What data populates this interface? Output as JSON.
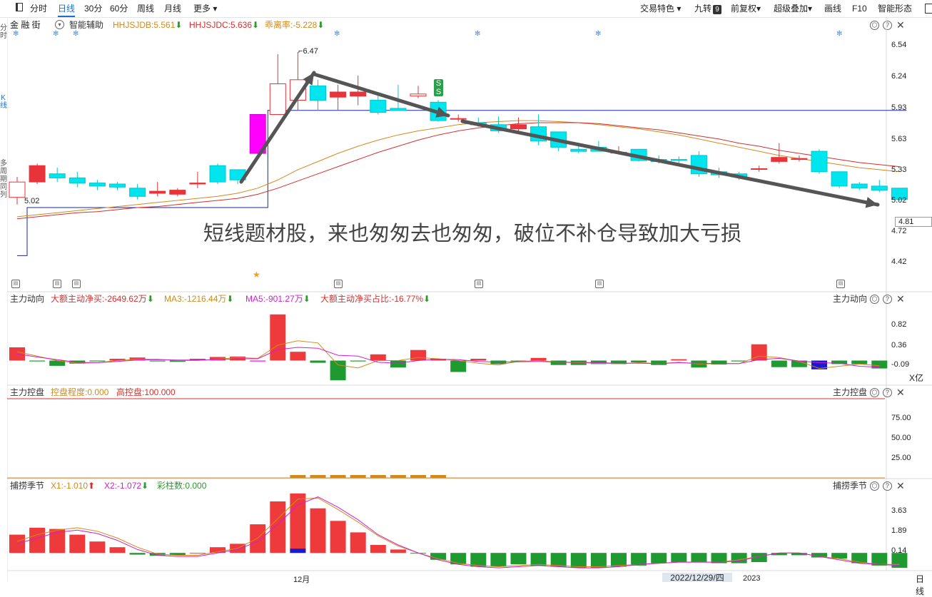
{
  "toolbar": {
    "periods": [
      "分时",
      "日线",
      "30分",
      "60分",
      "周线",
      "月线",
      "更多"
    ],
    "active_period": "日线",
    "right_items": [
      "交易特色",
      "九转",
      "前复权",
      "超级叠加",
      "画线",
      "F10",
      "智能形态"
    ],
    "jiuzhuan_badge": "9"
  },
  "stock": {
    "name": "金 融 街",
    "assist_label": "智能辅助"
  },
  "indicators": [
    {
      "label": "HHJSJDB:5.561",
      "arrow": "down",
      "color": "#d38a1c"
    },
    {
      "label": "HHJSJDC:5.636",
      "arrow": "down",
      "color": "#d43030"
    },
    {
      "label": "乖离率:-5.228",
      "arrow": "down",
      "color": "#d38a1c"
    }
  ],
  "left_tabs": [
    "分时",
    "K线",
    "多周期同列"
  ],
  "annotation": "短线题材股，来也匆匆去也匆匆，破位不补仓导致加大亏损",
  "main_chart": {
    "y_ticks": [
      6.54,
      6.24,
      5.93,
      5.63,
      5.33,
      5.02,
      4.72,
      4.42
    ],
    "current_price_label": "4.81",
    "high_label": "6.47",
    "low_label": "5.02",
    "signal_label": "S"
  },
  "panel_zldx": {
    "title": "主力动向",
    "legend": [
      {
        "label": "大额主动净买:-2649.62万",
        "arrow": "down",
        "color": "#d43030"
      },
      {
        "label": "MA3:-1216.44万",
        "arrow": "down",
        "color": "#d38a1c"
      },
      {
        "label": "MA5:-901.27万",
        "arrow": "down",
        "color": "#d020d0"
      },
      {
        "label": "大额主动净买占比:-16.77%",
        "arrow": "down",
        "color": "#d43030"
      }
    ],
    "y_ticks": [
      "0.82",
      "0.36",
      "-0.09"
    ],
    "unit": "X亿"
  },
  "panel_zlkp": {
    "title": "主力控盘",
    "legend": [
      {
        "label": "控盘程度:0.000",
        "color": "#d38a1c"
      },
      {
        "label": "高控盘:100.000",
        "color": "#d43030"
      }
    ],
    "y_ticks": [
      "75.00",
      "50.00",
      "25.00"
    ]
  },
  "panel_blj": {
    "title": "捕捞季节",
    "legend": [
      {
        "label": "X1:-1.010",
        "arrow": "up",
        "color": "#d38a1c"
      },
      {
        "label": "X2:-1.072",
        "arrow": "down",
        "color": "#d020d0"
      },
      {
        "label": "彩柱数:0.000",
        "color": "#2a9a2a"
      }
    ],
    "y_ticks": [
      "3.63",
      "1.89",
      "0.14"
    ]
  },
  "xaxis": {
    "month_label": "12月",
    "date_label": "2022/12/29/四",
    "year_label": "2023",
    "right_label": "日线"
  },
  "chart_data": {
    "type": "candlestick",
    "ylim": [
      4.3,
      6.6
    ],
    "candles": [
      {
        "o": 5.05,
        "h": 5.25,
        "l": 4.98,
        "c": 5.2
      },
      {
        "o": 5.2,
        "h": 5.38,
        "l": 5.18,
        "c": 5.36
      },
      {
        "o": 5.28,
        "h": 5.34,
        "l": 5.2,
        "c": 5.24
      },
      {
        "o": 5.24,
        "h": 5.3,
        "l": 5.15,
        "c": 5.19
      },
      {
        "o": 5.19,
        "h": 5.22,
        "l": 5.12,
        "c": 5.16
      },
      {
        "o": 5.18,
        "h": 5.2,
        "l": 5.12,
        "c": 5.15
      },
      {
        "o": 5.14,
        "h": 5.18,
        "l": 5.03,
        "c": 5.06
      },
      {
        "o": 5.09,
        "h": 5.2,
        "l": 5.06,
        "c": 5.11
      },
      {
        "o": 5.08,
        "h": 5.14,
        "l": 5.06,
        "c": 5.12
      },
      {
        "o": 5.18,
        "h": 5.3,
        "l": 5.14,
        "c": 5.19
      },
      {
        "o": 5.36,
        "h": 5.38,
        "l": 5.18,
        "c": 5.2
      },
      {
        "o": 5.32,
        "h": 5.32,
        "l": 5.18,
        "c": 5.22
      },
      {
        "o": 5.86,
        "h": 5.86,
        "l": 5.48,
        "c": 5.48
      },
      {
        "o": 5.86,
        "h": 6.45,
        "l": 5.86,
        "c": 6.16
      },
      {
        "o": 6.0,
        "h": 6.47,
        "l": 5.9,
        "c": 6.2
      },
      {
        "o": 6.14,
        "h": 6.2,
        "l": 5.9,
        "c": 6.0
      },
      {
        "o": 6.03,
        "h": 6.15,
        "l": 5.9,
        "c": 6.08
      },
      {
        "o": 6.04,
        "h": 6.24,
        "l": 5.95,
        "c": 6.08
      },
      {
        "o": 6.0,
        "h": 6.05,
        "l": 5.86,
        "c": 5.88
      },
      {
        "o": 5.92,
        "h": 6.15,
        "l": 5.9,
        "c": 5.9
      },
      {
        "o": 6.04,
        "h": 6.14,
        "l": 6.02,
        "c": 6.06
      },
      {
        "o": 5.98,
        "h": 6.0,
        "l": 5.79,
        "c": 5.8
      },
      {
        "o": 5.82,
        "h": 5.86,
        "l": 5.79,
        "c": 5.82
      },
      {
        "o": 5.78,
        "h": 5.83,
        "l": 5.74,
        "c": 5.76
      },
      {
        "o": 5.76,
        "h": 5.84,
        "l": 5.68,
        "c": 5.7
      },
      {
        "o": 5.72,
        "h": 5.83,
        "l": 5.7,
        "c": 5.76
      },
      {
        "o": 5.74,
        "h": 5.86,
        "l": 5.56,
        "c": 5.6
      },
      {
        "o": 5.69,
        "h": 5.69,
        "l": 5.5,
        "c": 5.54
      },
      {
        "o": 5.52,
        "h": 5.56,
        "l": 5.48,
        "c": 5.5
      },
      {
        "o": 5.54,
        "h": 5.6,
        "l": 5.5,
        "c": 5.5
      },
      {
        "o": 5.49,
        "h": 5.55,
        "l": 5.48,
        "c": 5.49
      },
      {
        "o": 5.52,
        "h": 5.52,
        "l": 5.4,
        "c": 5.41
      },
      {
        "o": 5.42,
        "h": 5.46,
        "l": 5.38,
        "c": 5.4
      },
      {
        "o": 5.42,
        "h": 5.45,
        "l": 5.36,
        "c": 5.41
      },
      {
        "o": 5.46,
        "h": 5.5,
        "l": 5.25,
        "c": 5.28
      },
      {
        "o": 5.3,
        "h": 5.34,
        "l": 5.24,
        "c": 5.27
      },
      {
        "o": 5.28,
        "h": 5.3,
        "l": 5.22,
        "c": 5.25
      },
      {
        "o": 5.33,
        "h": 5.36,
        "l": 5.3,
        "c": 5.33
      },
      {
        "o": 5.4,
        "h": 5.58,
        "l": 5.38,
        "c": 5.44
      },
      {
        "o": 5.42,
        "h": 5.46,
        "l": 5.4,
        "c": 5.43
      },
      {
        "o": 5.5,
        "h": 5.52,
        "l": 5.28,
        "c": 5.3
      },
      {
        "o": 5.3,
        "h": 5.3,
        "l": 5.14,
        "c": 5.16
      },
      {
        "o": 5.18,
        "h": 5.2,
        "l": 5.12,
        "c": 5.14
      },
      {
        "o": 5.16,
        "h": 5.22,
        "l": 5.1,
        "c": 5.12
      },
      {
        "o": 5.14,
        "h": 5.14,
        "l": 5.02,
        "c": 5.03
      }
    ],
    "ma_a": [
      4.86,
      4.88,
      4.9,
      4.92,
      4.94,
      4.96,
      4.98,
      5.0,
      5.02,
      5.04,
      5.06,
      5.09,
      5.14,
      5.22,
      5.32,
      5.4,
      5.48,
      5.55,
      5.61,
      5.66,
      5.7,
      5.73,
      5.76,
      5.78,
      5.79,
      5.8,
      5.8,
      5.79,
      5.78,
      5.76,
      5.74,
      5.72,
      5.69,
      5.66,
      5.62,
      5.58,
      5.54,
      5.5,
      5.46,
      5.43,
      5.4,
      5.37,
      5.34,
      5.32,
      5.3
    ],
    "ma_b": [
      4.84,
      4.86,
      4.88,
      4.9,
      4.91,
      4.93,
      4.95,
      4.96,
      4.98,
      5.0,
      5.02,
      5.04,
      5.08,
      5.14,
      5.21,
      5.28,
      5.35,
      5.42,
      5.49,
      5.55,
      5.61,
      5.66,
      5.7,
      5.73,
      5.75,
      5.77,
      5.78,
      5.78,
      5.78,
      5.77,
      5.75,
      5.73,
      5.71,
      5.68,
      5.65,
      5.62,
      5.58,
      5.55,
      5.51,
      5.48,
      5.45,
      5.42,
      5.39,
      5.37,
      5.35
    ],
    "blue_line": [
      4.48,
      4.95,
      4.95,
      4.95,
      4.95,
      4.95,
      4.95,
      4.95,
      4.95,
      4.95,
      4.95,
      4.95,
      4.95,
      5.9,
      5.9,
      5.9,
      5.9,
      5.9,
      5.9,
      5.9,
      5.9,
      5.9,
      5.9,
      5.9,
      5.9,
      5.9,
      5.9,
      5.9,
      5.9,
      5.9,
      5.9,
      5.9,
      5.9,
      5.9,
      5.9,
      5.9,
      5.9,
      5.9,
      5.9,
      5.9,
      5.9,
      5.9,
      5.9,
      5.9,
      5.9
    ],
    "zldx_bars": [
      0.3,
      -0.02,
      -0.12,
      -0.07,
      -0.02,
      0.04,
      0.07,
      -0.02,
      -0.03,
      0.04,
      0.08,
      0.09,
      -0.02,
      1.05,
      0.2,
      -0.05,
      -0.45,
      -0.02,
      0.14,
      -0.16,
      0.24,
      0.04,
      -0.26,
      0.04,
      -0.08,
      -0.02,
      0.06,
      -0.1,
      -0.1,
      -0.08,
      -0.08,
      -0.04,
      -0.1,
      0.03,
      -0.16,
      -0.09,
      -0.02,
      0.37,
      -0.15,
      -0.15,
      -0.2,
      -0.08,
      -0.08,
      -0.18
    ],
    "zldx_ma3": [
      0.2,
      0.1,
      0.0,
      -0.06,
      -0.05,
      0.0,
      0.03,
      0.03,
      0.0,
      0.0,
      0.03,
      0.07,
      0.05,
      0.35,
      0.45,
      0.4,
      -0.1,
      -0.17,
      0.0,
      0.0,
      0.07,
      0.04,
      0.0,
      -0.06,
      -0.1,
      -0.02,
      0.0,
      -0.04,
      -0.05,
      -0.06,
      -0.07,
      -0.05,
      -0.07,
      -0.04,
      -0.08,
      -0.07,
      -0.07,
      0.1,
      0.07,
      -0.02,
      -0.18,
      -0.13,
      -0.08,
      -0.12
    ],
    "zldx_ma5": [
      0.15,
      0.08,
      0.02,
      -0.04,
      -0.05,
      -0.02,
      0.01,
      0.02,
      0.01,
      0.01,
      0.02,
      0.04,
      0.04,
      0.25,
      0.3,
      0.28,
      0.12,
      0.1,
      -0.04,
      -0.06,
      0.0,
      0.03,
      0.02,
      -0.02,
      -0.04,
      -0.03,
      -0.02,
      -0.04,
      -0.04,
      -0.05,
      -0.06,
      -0.06,
      -0.07,
      -0.05,
      -0.06,
      -0.07,
      -0.07,
      0.02,
      0.05,
      -0.01,
      -0.05,
      -0.06,
      -0.13,
      -0.15
    ],
    "zlkp_bars": [
      0,
      0,
      0,
      0,
      0,
      0,
      0,
      0,
      0,
      0,
      0,
      0,
      0,
      0,
      2,
      2,
      2,
      2,
      2,
      2,
      2,
      2,
      0,
      0,
      0,
      0,
      0,
      0,
      0,
      0,
      0,
      0,
      0,
      0,
      0,
      0,
      0,
      0,
      0,
      0,
      0,
      0,
      0,
      0
    ],
    "blj_bars": [
      1.6,
      2.2,
      2.1,
      1.6,
      1.0,
      0.5,
      -0.15,
      -0.25,
      -0.2,
      0.0,
      0.5,
      0.8,
      2.5,
      4.5,
      5.2,
      3.9,
      2.8,
      1.8,
      0.7,
      0.3,
      -0.05,
      -0.6,
      -1.0,
      -1.2,
      -1.2,
      -1.0,
      -1.1,
      -1.2,
      -1.3,
      -1.3,
      -1.2,
      -1.1,
      -0.9,
      -0.8,
      -0.8,
      -0.9,
      -0.9,
      -0.8,
      -0.2,
      -0.2,
      -0.4,
      -0.5,
      -0.9,
      -1.1,
      -1.3
    ],
    "blj_x1": [
      1.0,
      1.6,
      2.0,
      2.2,
      1.9,
      1.3,
      0.5,
      -0.1,
      -0.2,
      -0.2,
      0.1,
      0.4,
      1.3,
      3.0,
      4.7,
      4.8,
      3.8,
      2.7,
      1.5,
      0.6,
      0.0,
      -0.5,
      -0.9,
      -1.1,
      -1.2,
      -1.1,
      -1.0,
      -1.1,
      -1.2,
      -1.2,
      -1.1,
      -1.0,
      -0.9,
      -0.8,
      -0.8,
      -0.8,
      -0.6,
      -0.3,
      0.0,
      0.0,
      -0.3,
      -0.5,
      -0.8,
      -1.0,
      -1.0
    ],
    "blj_x2": [
      0.8,
      1.3,
      1.8,
      2.0,
      1.7,
      1.1,
      0.3,
      -0.2,
      -0.3,
      -0.3,
      0.0,
      0.3,
      1.0,
      2.5,
      4.2,
      4.9,
      4.0,
      2.9,
      1.6,
      0.7,
      0.0,
      -0.6,
      -1.0,
      -1.2,
      -1.3,
      -1.2,
      -1.1,
      -1.2,
      -1.3,
      -1.3,
      -1.2,
      -1.0,
      -0.9,
      -0.8,
      -0.8,
      -0.8,
      -0.7,
      -0.3,
      0.0,
      0.0,
      -0.3,
      -0.6,
      -0.9,
      -1.0,
      -1.1
    ]
  }
}
